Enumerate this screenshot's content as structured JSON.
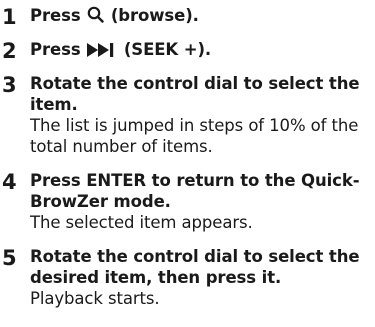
{
  "steps": [
    {
      "number": "1",
      "title_before": "Press ",
      "title_icon": "search-icon",
      "title_after": " (browse).",
      "body": ""
    },
    {
      "number": "2",
      "title_before": "Press ",
      "title_icon": "seek-forward-icon",
      "title_after": " (SEEK +).",
      "body": ""
    },
    {
      "number": "3",
      "title": "Rotate the control dial to select the item.",
      "body": "The list is jumped in steps of 10% of the total number of items."
    },
    {
      "number": "4",
      "title": "Press ENTER to return to the Quick-BrowZer mode.",
      "body": "The selected item appears."
    },
    {
      "number": "5",
      "title": "Rotate the control dial to select the desired item, then press it.",
      "body": "Playback starts."
    }
  ]
}
